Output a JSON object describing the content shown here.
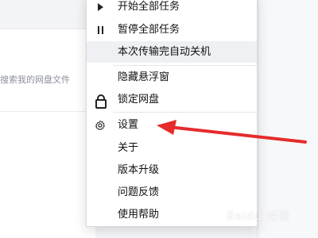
{
  "background": {
    "search_placeholder": "搜索我的网盘文件"
  },
  "menu": {
    "start_all": "开始全部任务",
    "pause_all": "暂停全部任务",
    "shutdown_after": "本次传输完自动关机",
    "hide_float": "隐藏悬浮窗",
    "lock_disk": "锁定网盘",
    "settings": "设置",
    "about": "关于",
    "upgrade": "版本升级",
    "feedback": "问题反馈",
    "help": "使用帮助"
  },
  "annotation": {
    "arrow_color": "#e52b2b"
  },
  "watermark": {
    "text": "Baidu 经验"
  }
}
